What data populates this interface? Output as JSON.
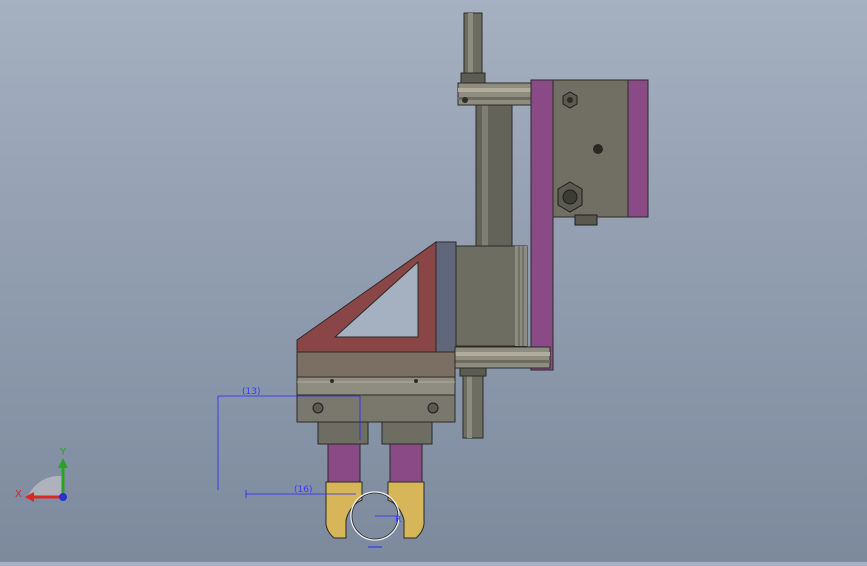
{
  "view": {
    "background_top": "#a5b0c0",
    "background_bottom": "#7d899c"
  },
  "dimensions": {
    "upper": "(13)",
    "lower": "(16)",
    "radius": "R"
  },
  "triad": {
    "x_label": "X",
    "y_label": "Y",
    "x_color": "#d9262b",
    "y_color": "#27a327",
    "z_color": "#2433d1"
  },
  "colors": {
    "steel": "#6b6a5e",
    "purple": "#8a4a86",
    "maroon": "#8a4646",
    "slate": "#60677a",
    "gold": "#d7b65a",
    "dimension": "#2828ff"
  }
}
